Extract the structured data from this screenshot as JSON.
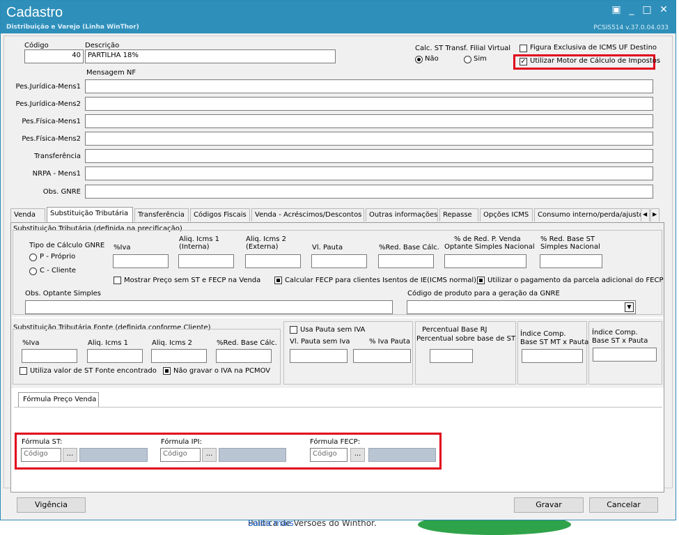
{
  "background": {
    "bottom_text": "Política de Versões do Winthor.",
    "bottom_link": "Saiba mais"
  },
  "window": {
    "title": "Cadastro",
    "subtitle": "Distribuição e Varejo (Linha WinThor)",
    "version": "PCSIS514  v.37.0.04.033",
    "btn_restore": "▣",
    "btn_min": "_",
    "btn_max": "□",
    "btn_close": "✕"
  },
  "header": {
    "codigo_label": "Código",
    "codigo_value": "40",
    "descricao_label": "Descrição",
    "descricao_value": "PARTILHA 18%",
    "calc_st_label": "Calc. ST Transf. Filial Virtual",
    "radio_nao": "Não",
    "radio_sim": "Sim",
    "figura_label": "Figura Exclusiva de ICMS UF Destino",
    "motor_label": "Utilizar Motor de Cálculo de Impostos",
    "mensagem_nf": "Mensagem NF"
  },
  "messages": [
    {
      "label": "Pes.Jurídica-Mens1",
      "value": ""
    },
    {
      "label": "Pes.Jurídica-Mens2",
      "value": ""
    },
    {
      "label": "Pes.Física-Mens1",
      "value": ""
    },
    {
      "label": "Pes.Física-Mens2",
      "value": ""
    },
    {
      "label": "Transferência",
      "value": ""
    },
    {
      "label": "NRPA - Mens1",
      "value": ""
    },
    {
      "label": "Obs. GNRE",
      "value": ""
    }
  ],
  "tabs": [
    "Venda",
    "Substituição Tributária",
    "Transferência",
    "Códigos Fiscais",
    "Venda - Acréscimos/Descontos",
    "Outras informações",
    "Repasse",
    "Opções ICMS",
    "Consumo interno/perda/ajuste"
  ],
  "st": {
    "group_title": "Substituição Tributária (definida na precificação)",
    "gnre_title": "Tipo de Cálculo GNRE",
    "opt_p": "P - Próprio",
    "opt_c": "C - Cliente",
    "col_iva": "%Iva",
    "col_aliq1a": "Aliq. Icms 1",
    "col_aliq1b": "(Interna)",
    "col_aliq2a": "Aliq. Icms 2",
    "col_aliq2b": "(Externa)",
    "col_pauta": "Vl. Pauta",
    "col_redbase": "%Red. Base Cálc.",
    "col_redpv_a": "% de Red. P. Venda",
    "col_redpv_b": "Optante Simples Nacional",
    "col_redst_a": "% Red. Base ST",
    "col_redst_b": "Simples Nacional",
    "chk_mostrar": "Mostrar Preço sem ST e FECP na Venda",
    "chk_calcular": "Calcular FECP para clientes Isentos de IE(ICMS normal)",
    "chk_utilizar": "Utilizar o pagamento da parcela adicional do FECP",
    "obs_label": "Obs. Optante Simples",
    "gnre_code_label": "Código de produto para a geração da GNRE"
  },
  "fonte": {
    "group_title": "Substituição Tributária Fonte (definida conforme Cliente)",
    "col_iva": "%Iva",
    "col_aliq1": "Aliq. Icms 1",
    "col_aliq2": "Aliq. Icms 2",
    "col_red": "%Red. Base Cálc.",
    "chk_utiliza": "Utiliza valor de ST Fonte encontrado",
    "chk_nao_gravar": "Não gravar o IVA na PCMOV",
    "chk_pauta": "Usa Pauta sem IVA",
    "pauta_sem_iva": "Vl. Pauta sem Iva",
    "iva_pauta": "% Iva Pauta",
    "perc_title": "Percentual Base RJ",
    "perc_label": "Percentual sobre base de ST",
    "indice1_a": "Índice Comp.",
    "indice1_b": "Base ST MT x Pauta",
    "indice2_a": "Índice Comp.",
    "indice2_b": "Base ST x Pauta"
  },
  "formula": {
    "tab": "Fórmula Preço Venda",
    "st_label": "Fórmula ST:",
    "ipi_label": "Fórmula IPI:",
    "fecp_label": "Fórmula FECP:",
    "placeholder": "Código",
    "dots": "..."
  },
  "footer": {
    "vigencia": "Vigência",
    "gravar": "Gravar",
    "cancelar": "Cancelar"
  },
  "colors": {
    "titlebar": "#2e8fba",
    "highlight": "#e0001b"
  }
}
